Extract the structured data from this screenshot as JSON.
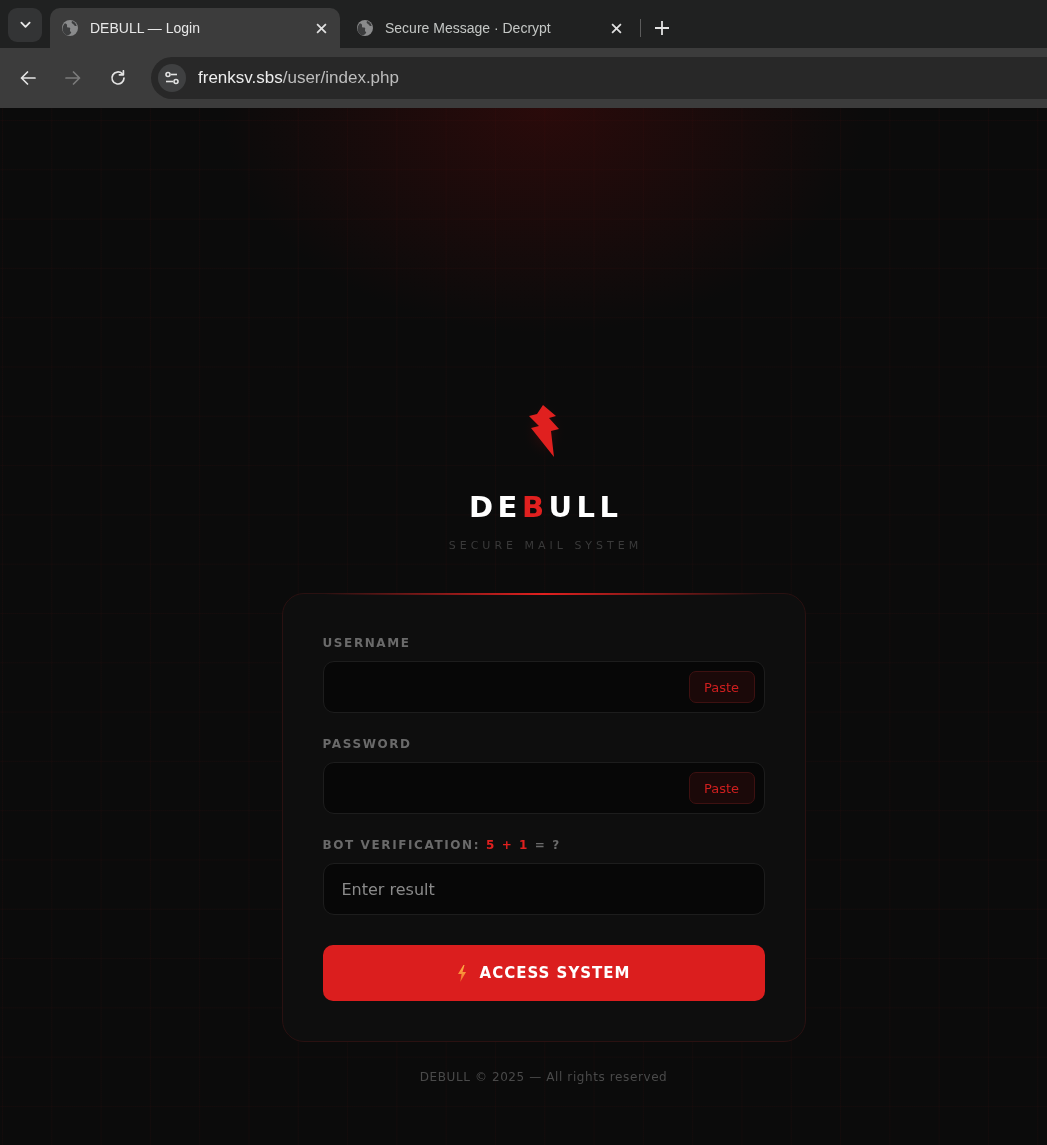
{
  "browser": {
    "tabs": [
      {
        "title": "DEBULL — Login",
        "selected": true
      },
      {
        "title": "Secure Message · Decrypt",
        "selected": false
      }
    ],
    "nav_buttons": [
      {
        "kind": "back",
        "disabled": false
      },
      {
        "kind": "forward",
        "disabled": true
      },
      {
        "kind": "reload",
        "disabled": false
      }
    ],
    "address": {
      "host": "frenksv.sbs",
      "path": "/user/index.php"
    }
  },
  "brand": {
    "name": [
      {
        "text": "DE",
        "accent": false
      },
      {
        "text": "B",
        "accent": true
      },
      {
        "text": "ULL",
        "accent": false
      }
    ],
    "tagline": "SECURE MAIL SYSTEM"
  },
  "form": {
    "fields": [
      {
        "kind": "paste",
        "label": "USERNAME",
        "button": "Paste"
      },
      {
        "kind": "paste",
        "label": "PASSWORD",
        "button": "Paste"
      },
      {
        "kind": "captcha",
        "label": "BOT VERIFICATION:",
        "challenge": "5 + 1",
        "suffix": "= ?",
        "placeholder": "Enter result"
      }
    ],
    "submit": "ACCESS SYSTEM"
  },
  "footer": "DEBULL © 2025 — All rights reserved"
}
